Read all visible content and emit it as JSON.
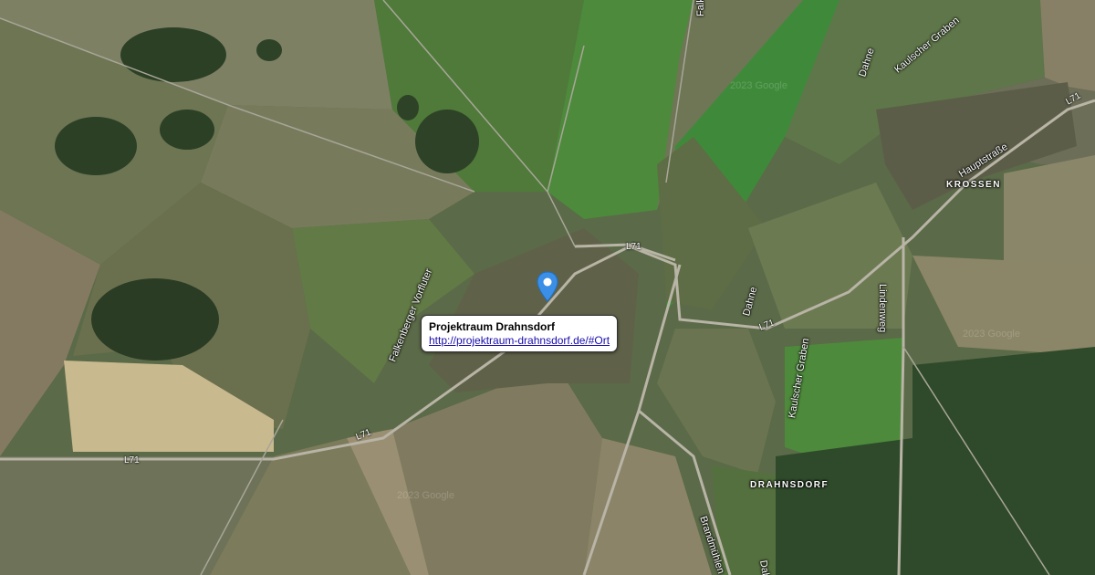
{
  "map": {
    "type": "satellite",
    "watermark": "2023 Google"
  },
  "marker": {
    "color": "#3b8fe6",
    "icon": "map-pin-icon"
  },
  "popup": {
    "title": "Projektraum Drahnsdorf",
    "link": "http://projektraum-drahnsdorf.de/#Ort"
  },
  "roads": {
    "l71_a": "L71",
    "l71_b": "L71",
    "l71_c": "L71",
    "l71_d": "L71",
    "l71_e": "L71",
    "hauptstrasse": "Hauptstraße",
    "lindenweg": "Lindenweg",
    "falkenberg": "Falken",
    "brandmuhlen": "Brandmühlen",
    "vorfluter": "Falkenberger Vorfluter"
  },
  "water": {
    "dahne_top": "Dahne",
    "dahne_mid": "Dahne",
    "dahne_bottom": "Dahn",
    "kaulscher_top": "Kaulscher Graben",
    "kaulscher_mid": "Kaulscher Graben"
  },
  "places": {
    "krossen": "KROSSEN",
    "drahnsdorf": "DRAHNSDORF",
    "drahnsdorf_partial": "sdorf"
  }
}
